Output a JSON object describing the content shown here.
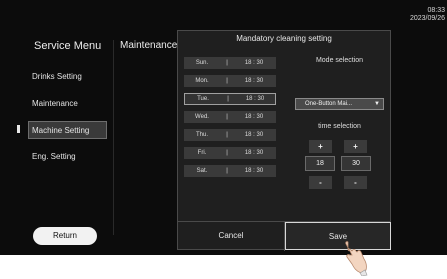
{
  "status": {
    "time": "08:33",
    "date": "2023/09/26"
  },
  "sidebar": {
    "title": "Service Menu",
    "items": [
      {
        "label": "Drinks Setting"
      },
      {
        "label": "Maintenance"
      },
      {
        "label": "Machine Setting"
      },
      {
        "label": "Eng. Setting"
      }
    ],
    "active_item": "Machine Setting",
    "return_label": "Return"
  },
  "main": {
    "breadcrumb": "Maintenance Setting>"
  },
  "dialog": {
    "title": "Mandatory cleaning setting",
    "days": [
      {
        "day": "Sun.",
        "time": "18 : 30"
      },
      {
        "day": "Mon.",
        "time": "18 : 30"
      },
      {
        "day": "Tue.",
        "time": "18 : 30"
      },
      {
        "day": "Wed.",
        "time": "18 : 30"
      },
      {
        "day": "Thu.",
        "time": "18 : 30"
      },
      {
        "day": "Fri.",
        "time": "18 : 30"
      },
      {
        "day": "Sat.",
        "time": "18 : 30"
      }
    ],
    "day_separator": "|",
    "selected_day": "Tue.",
    "mode_label": "Mode selection",
    "mode_value": "One-Button Mai...",
    "mode_arrow": "▼",
    "time_label": "time selection",
    "hour": "18",
    "minute": "30",
    "plus": "+",
    "minus": "-",
    "cancel_label": "Cancel",
    "save_label": "Save"
  },
  "icons": {
    "mode_dropdown": "chevron-down-icon",
    "hand": "pointing-hand-icon"
  }
}
